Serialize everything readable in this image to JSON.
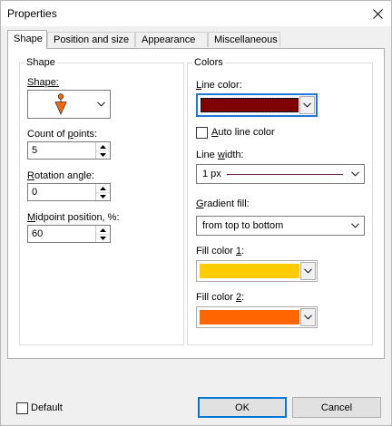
{
  "window": {
    "title": "Properties"
  },
  "tabs": [
    {
      "label": "Shape"
    },
    {
      "label": "Position and size"
    },
    {
      "label": "Appearance"
    },
    {
      "label": "Miscellaneous"
    }
  ],
  "shape_group": {
    "legend": "Shape",
    "shape_label": "Shape:",
    "shape_icon": "orange-pin-marker-icon",
    "count_label": "Count of points:",
    "count_value": "5",
    "rotation_label": "Rotation angle:",
    "rotation_value": "0",
    "midpoint_label": "Midpoint position, %:",
    "midpoint_value": "60"
  },
  "colors_group": {
    "legend": "Colors",
    "line_color_label": "Line color:",
    "line_color": "#800000",
    "auto_line_color_label": "Auto line color",
    "auto_line_color_checked": false,
    "line_width_label": "Line width:",
    "line_width_value": "1 px",
    "line_width_sample_color": "#6e2a5a",
    "gradient_label": "Gradient fill:",
    "gradient_value": "from top to bottom",
    "fill1_label": "Fill color 1:",
    "fill1_color": "#ffcc00",
    "fill2_label": "Fill color 2:",
    "fill2_color": "#ff6600"
  },
  "footer": {
    "default_label": "Default",
    "default_checked": false,
    "ok_label": "OK",
    "cancel_label": "Cancel"
  }
}
